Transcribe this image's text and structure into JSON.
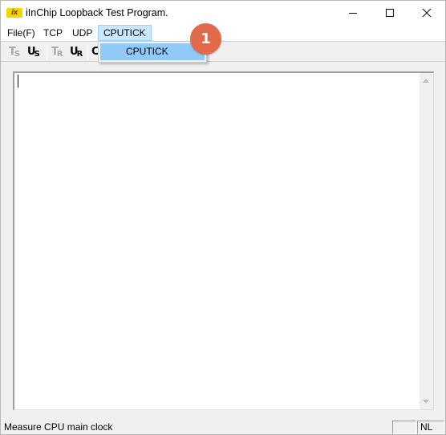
{
  "window": {
    "title": "iInChip Loopback Test Program.",
    "app_icon_text": "ix",
    "controls": {
      "minimize": "minimize",
      "maximize": "maximize",
      "close": "✕"
    }
  },
  "menubar": {
    "items": [
      {
        "label": "File(F)"
      },
      {
        "label": "TCP"
      },
      {
        "label": "UDP"
      },
      {
        "label": "CPUTICK"
      }
    ],
    "active_menu": "CPUTICK"
  },
  "toolbar": {
    "items": [
      {
        "name": "tcp-server",
        "main": "T",
        "sub": "S",
        "enabled": false
      },
      {
        "name": "udp-server",
        "main": "U",
        "sub": "S",
        "enabled": true
      },
      {
        "name": "tcp-receive",
        "main": "T",
        "sub": "R",
        "enabled": false
      },
      {
        "name": "udp-receive",
        "main": "U",
        "sub": "R",
        "enabled": true
      },
      {
        "name": "cputick",
        "main": "C",
        "sub": "",
        "enabled": true
      }
    ]
  },
  "dropdown": {
    "items": [
      {
        "label": "CPUTICK",
        "highlighted": true
      }
    ]
  },
  "callout": {
    "number": "1",
    "color": "#e06a4a"
  },
  "statusbar": {
    "message": "Measure CPU main clock",
    "pane_1": "",
    "pane_2": "NL"
  },
  "colors": {
    "menu_highlight": "#cce8ff",
    "dropdown_highlight": "#91c9f7"
  }
}
